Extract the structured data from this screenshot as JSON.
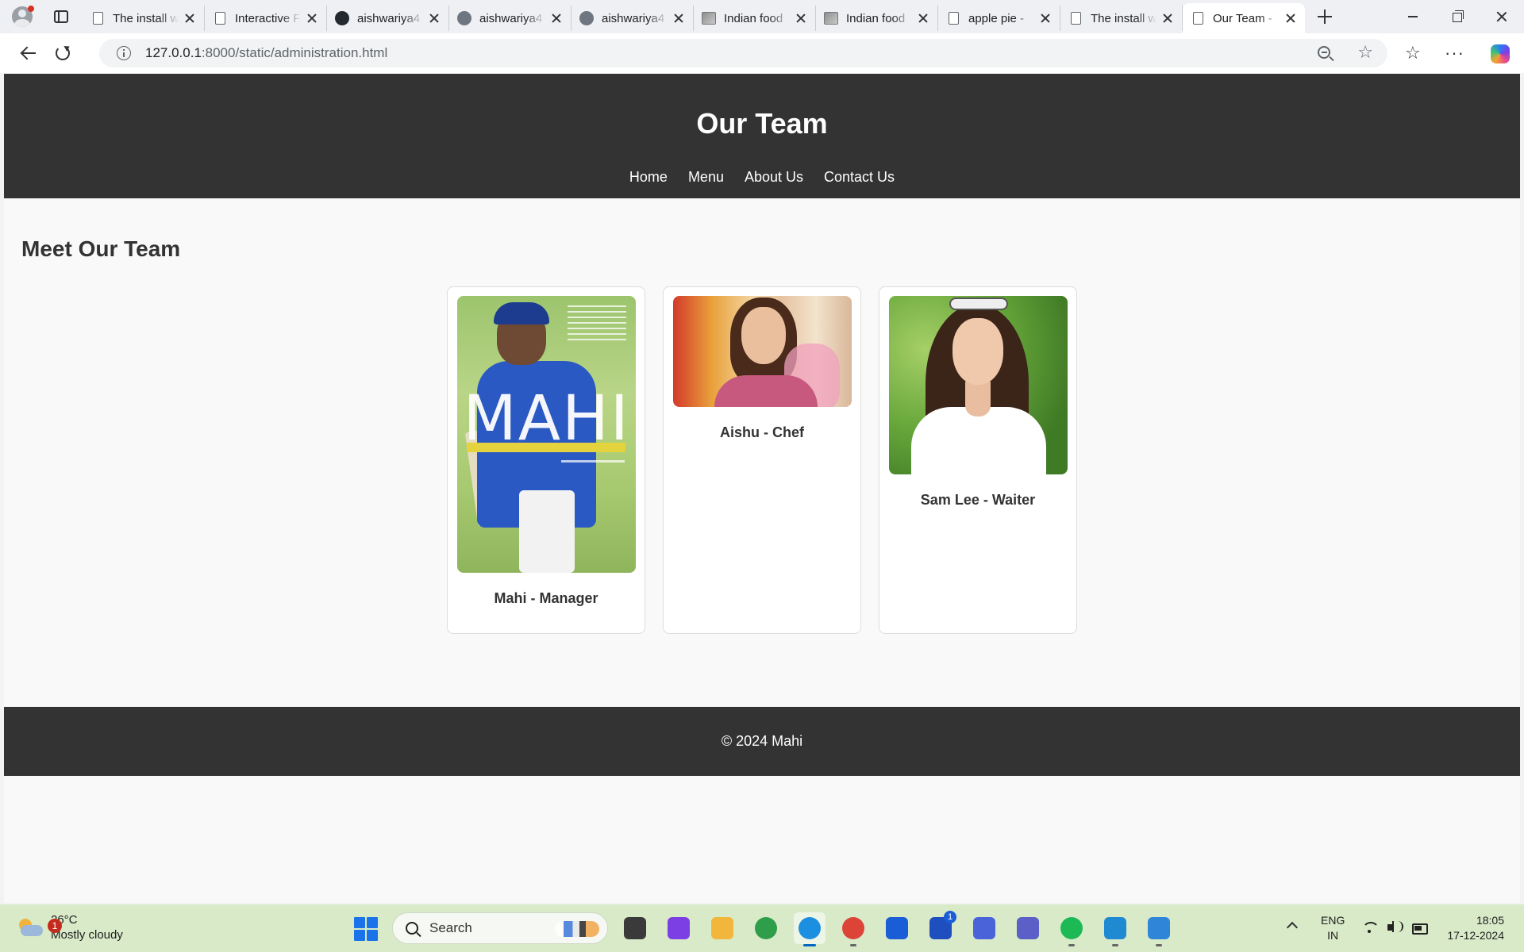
{
  "browser": {
    "tabs": [
      {
        "title": "The install w",
        "icon": "page-icon"
      },
      {
        "title": "Interactive F",
        "icon": "page-icon"
      },
      {
        "title": "aishwariya4",
        "icon": "github-icon"
      },
      {
        "title": "aishwariya4",
        "icon": "github-icon"
      },
      {
        "title": "aishwariya4",
        "icon": "github-icon"
      },
      {
        "title": "Indian food",
        "icon": "image-icon"
      },
      {
        "title": "Indian food",
        "icon": "image-icon"
      },
      {
        "title": "apple pie -",
        "icon": "page-icon"
      },
      {
        "title": "The install w",
        "icon": "page-icon"
      },
      {
        "title": "Our Team -",
        "icon": "page-icon",
        "active": true
      }
    ],
    "address": {
      "host": "127.0.0.1",
      "rest": ":8000/static/administration.html"
    }
  },
  "site": {
    "title": "Our Team",
    "nav": [
      "Home",
      "Menu",
      "About Us",
      "Contact Us"
    ],
    "section_title": "Meet Our Team",
    "team": [
      {
        "name": "Mahi - Manager",
        "photo": "book-cover-photo"
      },
      {
        "name": "Aishu - Chef",
        "photo": "portrait-photo"
      },
      {
        "name": "Sam Lee - Waiter",
        "photo": "portrait-photo"
      }
    ],
    "footer": "© 2024 Mahi"
  },
  "taskbar": {
    "weather": {
      "temp": "26°C",
      "condition": "Mostly cloudy",
      "badge": "1"
    },
    "search_label": "Search",
    "apps": [
      {
        "name": "task-view",
        "color": "#3a3a3a"
      },
      {
        "name": "copilot",
        "color": "#7b3fe4"
      },
      {
        "name": "file-explorer",
        "color": "#f2b63c"
      },
      {
        "name": "app-ring",
        "color": "#2e9e4a"
      },
      {
        "name": "edge",
        "color": "#1d8fe1",
        "active": true
      },
      {
        "name": "chrome",
        "color": "#db4437"
      },
      {
        "name": "store",
        "color": "#1a5dd6"
      },
      {
        "name": "l-app",
        "color": "#1f4fbf",
        "badge": "1"
      },
      {
        "name": "arc-app",
        "color": "#4a63d8"
      },
      {
        "name": "teams",
        "color": "#5b5fc7"
      },
      {
        "name": "spotify",
        "color": "#1db954"
      },
      {
        "name": "vscode",
        "color": "#1f8ad2"
      },
      {
        "name": "notepad",
        "color": "#2f86d9"
      }
    ],
    "lang": {
      "line1": "ENG",
      "line2": "IN"
    },
    "clock": {
      "time": "18:05",
      "date": "17-12-2024"
    }
  }
}
